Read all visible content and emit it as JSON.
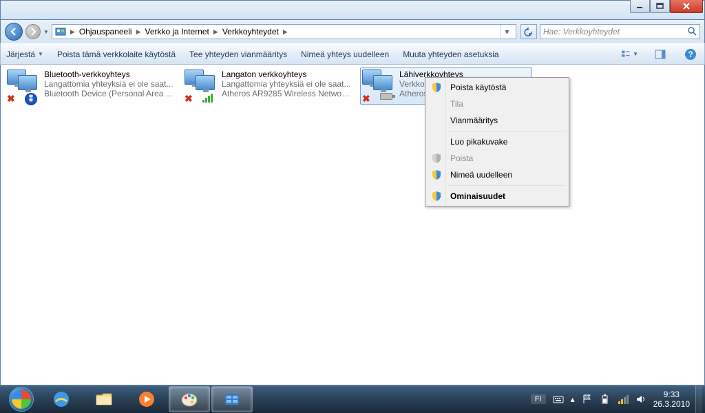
{
  "breadcrumb": {
    "root_icon": "control-panel",
    "items": [
      "Ohjauspaneeli",
      "Verkko ja Internet",
      "Verkkoyhteydet"
    ]
  },
  "search": {
    "placeholder": "Hae: Verkkoyhteydet"
  },
  "toolbar": {
    "organize": "Järjestä",
    "disable": "Poista tämä verkkolaite käytöstä",
    "diagnose": "Tee yhteyden vianmääritys",
    "rename": "Nimeä yhteys uudelleen",
    "change": "Muuta yhteyden asetuksia"
  },
  "connections": [
    {
      "name": "Bluetooth-verkkoyhteys",
      "status": "Langattomia yhteyksiä ei ole saat...",
      "device": "Bluetooth Device (Personal Area ...",
      "icon": "bluetooth",
      "disabled": true
    },
    {
      "name": "Langaton verkkoyhteys",
      "status": "Langattomia yhteyksiä ei ole saat...",
      "device": "Atheros AR9285 Wireless Network...",
      "icon": "wifi",
      "disabled": true
    },
    {
      "name": "Lähiverkkoyhteys",
      "status": "Verkkokaap",
      "device": "Atheros AR",
      "icon": "ethernet",
      "disabled": true,
      "selected": true
    }
  ],
  "context_menu": {
    "disable": "Poista käytöstä",
    "status": "Tila",
    "diagnose": "Vianmääritys",
    "shortcut": "Luo pikakuvake",
    "delete": "Poista",
    "rename": "Nimeä uudelleen",
    "properties": "Ominaisuudet"
  },
  "tray": {
    "lang": "FI",
    "time": "9:33",
    "date": "26.3.2010"
  }
}
